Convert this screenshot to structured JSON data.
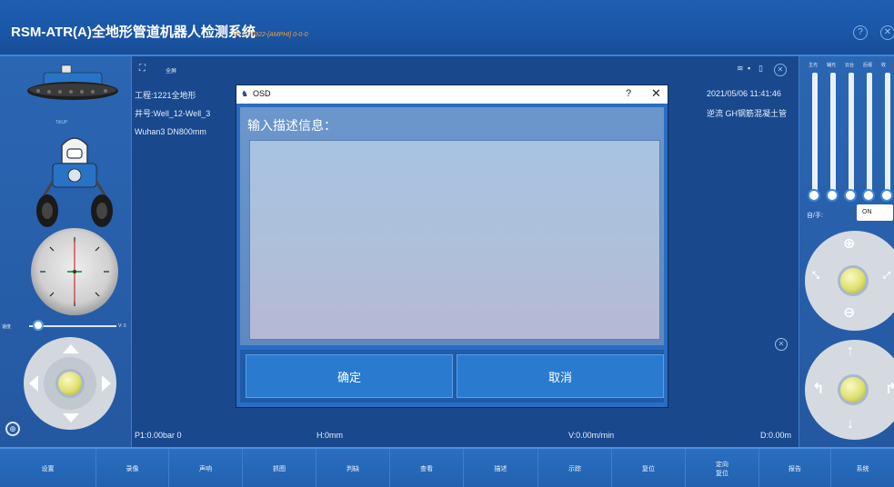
{
  "header": {
    "title": "RSM-ATR(A)全地形管道机器人检测系统",
    "version": "V1.0.20922-[AMPHI] 0-0-0",
    "help_icon": "?",
    "close_icon": "✕"
  },
  "left_panel": {
    "robot_front_label": "TiltUP",
    "slider_left_label": "速度",
    "slider_right_label": "V: 0"
  },
  "info": {
    "fullscreen_label": "全屏",
    "project": "工程:1221全地形",
    "well": "井号:Well_12-Well_3",
    "pipe": "Wuhan3 DN800mm",
    "datetime": "2021/05/06 11:41:46",
    "flow": "逆流 GH钢筋混凝土管"
  },
  "dialog": {
    "title": "OSD",
    "help": "?",
    "close": "✕",
    "prompt": "输入描述信息：",
    "input_value": "",
    "confirm": "确定",
    "cancel": "取消"
  },
  "status": {
    "pressure": "P1:0.00bar  0",
    "height": "H:0mm",
    "velocity": "V:0.00m/min",
    "distance": "D:0.00m"
  },
  "right_panel": {
    "slider_labels": [
      "主光",
      "辅光",
      "云台",
      "后视",
      "收"
    ],
    "mode_label": "自/手:",
    "toggle_label": "ON"
  },
  "toolbar": {
    "items": [
      "设置",
      "录像",
      "声响",
      "抓图",
      "判缺",
      "查看",
      "描述",
      "示踪",
      "复位",
      "定向\n复位",
      "报告",
      "系统"
    ]
  },
  "colors": {
    "header_bg": "#1a56a6",
    "panel_bg": "#2458a1",
    "center_bg": "#19488c",
    "accent_orange": "#f0a23c",
    "button_blue": "#2a7ad0"
  }
}
